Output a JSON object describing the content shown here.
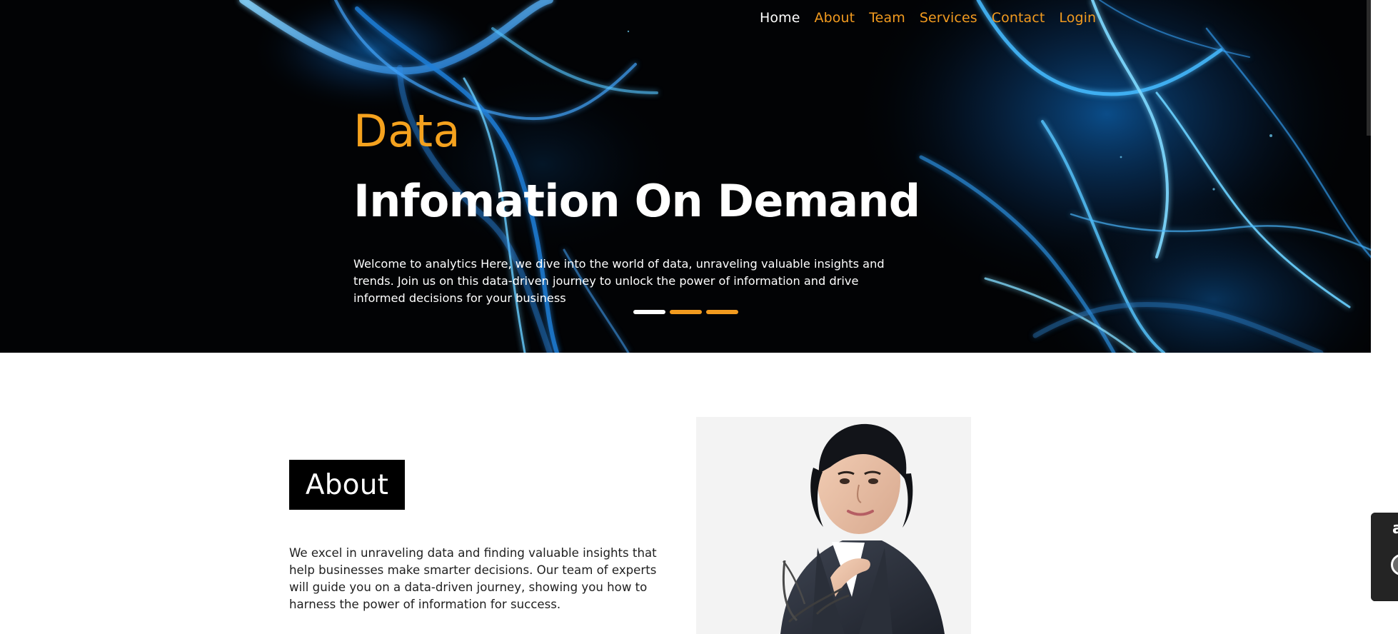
{
  "nav": {
    "items": [
      {
        "label": "Home",
        "active": true
      },
      {
        "label": "About",
        "active": false
      },
      {
        "label": "Team",
        "active": false
      },
      {
        "label": "Services",
        "active": false
      },
      {
        "label": "Contact",
        "active": false
      },
      {
        "label": "Login",
        "active": false
      }
    ]
  },
  "hero": {
    "kicker": "Data",
    "title": "Infomation On Demand",
    "description": "Welcome to analytics Here, we dive into the world of data, unraveling valuable insights and trends. Join us on this data-driven journey to unlock the power of information and drive informed decisions for your business",
    "carousel": {
      "count": 3,
      "active_index": 0
    }
  },
  "about": {
    "heading": "About",
    "description": "We excel in unraveling data and finding valuable insights that help businesses make smarter decisions. Our team of experts will guide you on a data-driven journey, showing you how to harness the power of information for success."
  },
  "side_widget": {
    "letter": "a"
  },
  "colors": {
    "accent_orange": "#f29b1f",
    "hero_background": "#020305",
    "text_white": "#ffffff",
    "text_dark": "#1f1f1f",
    "black": "#000000"
  },
  "icons": {
    "hero_art": "blue-light-filaments",
    "portrait": "woman-holding-glasses-photo"
  }
}
